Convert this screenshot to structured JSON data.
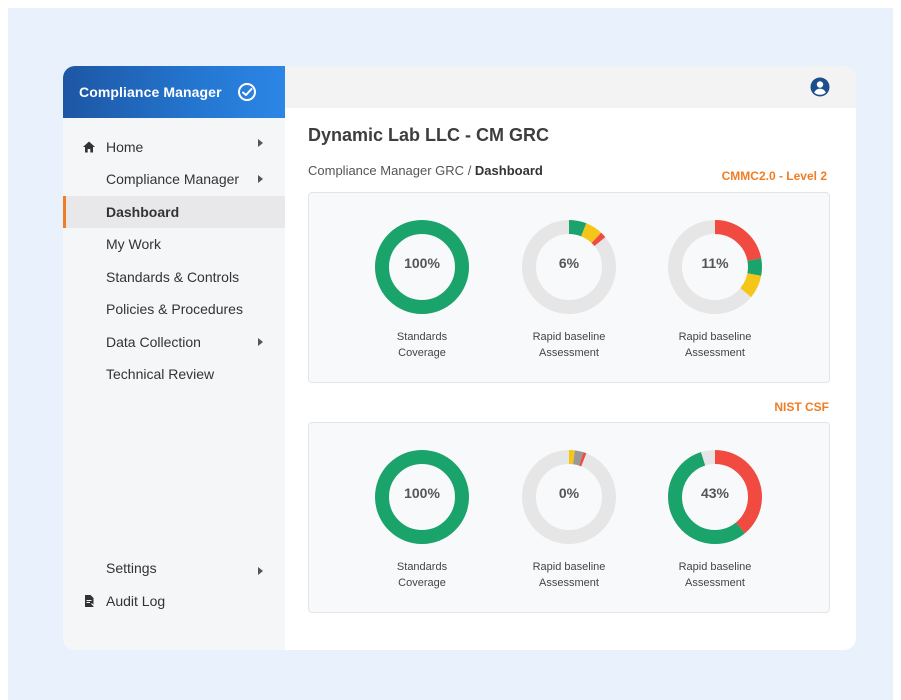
{
  "app": {
    "brand_title": "Compliance Manager"
  },
  "sidebar": {
    "items": [
      {
        "label": "Home",
        "has_caret": true,
        "icon": "home-icon"
      },
      {
        "label": "Compliance Manager",
        "has_caret": true
      },
      {
        "label": "Dashboard",
        "active": true
      },
      {
        "label": "My Work"
      },
      {
        "label": "Standards & Controls"
      },
      {
        "label": "Policies & Procedures"
      },
      {
        "label": "Data Collection",
        "has_caret": true
      },
      {
        "label": "Technical Review"
      }
    ],
    "bottom_items": [
      {
        "label": "Settings",
        "has_caret": true
      },
      {
        "label": "Audit Log",
        "icon": "audit-log-icon"
      }
    ]
  },
  "header": {
    "page_title": "Dynamic Lab LLC - CM GRC",
    "breadcrumb_parent": "Compliance Manager GRC",
    "breadcrumb_sep": " / ",
    "breadcrumb_current": "Dashboard"
  },
  "sections": [
    {
      "tag": "CMMC2.0 - Level 2",
      "gauges": [
        {
          "percent": "100%",
          "caption_line1": "Standards",
          "caption_line2": "Coverage",
          "segments": [
            {
              "color": "#1aa36b",
              "fraction": 1.0
            }
          ]
        },
        {
          "percent": "6%",
          "caption_line1": "Rapid baseline",
          "caption_line2": "Assessment",
          "segments": [
            {
              "color": "#1aa36b",
              "fraction": 0.06
            },
            {
              "color": "#f5c518",
              "fraction": 0.06
            },
            {
              "color": "#f04a41",
              "fraction": 0.02
            }
          ]
        },
        {
          "percent": "11%",
          "caption_line1": "Rapid baseline",
          "caption_line2": "Assessment",
          "segments": [
            {
              "color": "#f04a41",
              "fraction": 0.22
            },
            {
              "color": "#1aa36b",
              "fraction": 0.06
            },
            {
              "color": "#f5c518",
              "fraction": 0.08
            }
          ]
        }
      ]
    },
    {
      "tag": "NIST CSF",
      "gauges": [
        {
          "percent": "100%",
          "caption_line1": "Standards",
          "caption_line2": "Coverage",
          "segments": [
            {
              "color": "#1aa36b",
              "fraction": 1.0
            }
          ]
        },
        {
          "percent": "0%",
          "caption_line1": "Rapid baseline",
          "caption_line2": "Assessment",
          "segments": [
            {
              "color": "#f5c518",
              "fraction": 0.02
            },
            {
              "color": "#999999",
              "fraction": 0.03
            },
            {
              "color": "#f04a41",
              "fraction": 0.01
            }
          ]
        },
        {
          "percent": "43%",
          "caption_line1": "Rapid baseline",
          "caption_line2": "Assessment",
          "segments": [
            {
              "color": "#f04a41",
              "fraction": 0.39
            },
            {
              "color": "#1aa36b",
              "fraction": 0.56
            }
          ]
        }
      ]
    }
  ],
  "colors": {
    "accent": "#f07d24",
    "brand": "#1d56a4",
    "success": "#1aa36b",
    "warning": "#f5c518",
    "danger": "#f04a41",
    "track": "#e6e6e6"
  }
}
